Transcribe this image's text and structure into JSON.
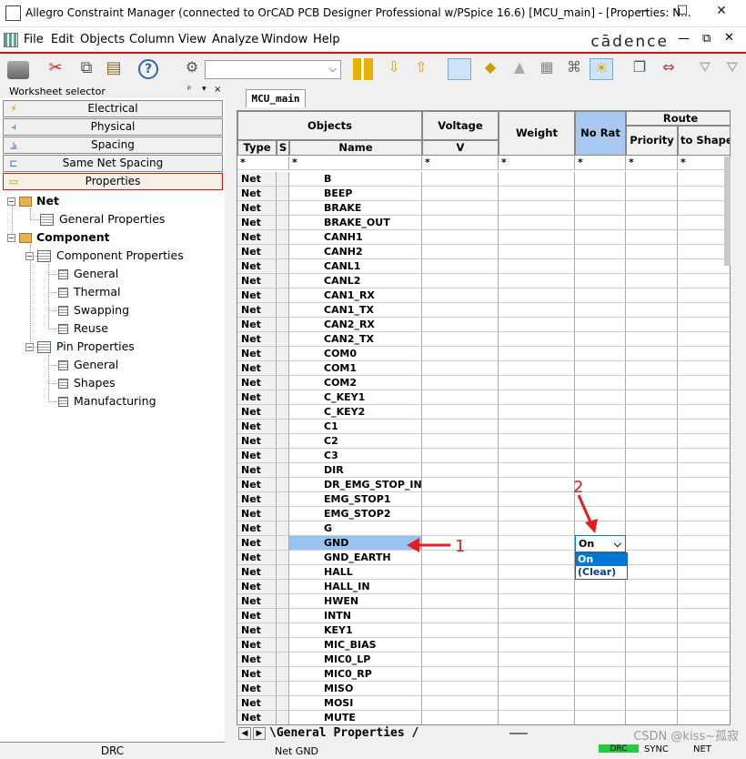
{
  "window": {
    "title": "Allegro Constraint Manager (connected to OrCAD PCB Designer Professional w/PSpice 16.6) [MCU_main] - [Properties: N...",
    "controls": [
      "—",
      "☐",
      "✕"
    ]
  },
  "menu": [
    "File",
    "Edit",
    "Objects",
    "Column",
    "View",
    "Analyze",
    "Window",
    "Help"
  ],
  "brand": "cādence",
  "mdi_controls": [
    "—",
    "⧉",
    "✕"
  ],
  "toolbar": {
    "combo_value": "",
    "combo_arrow": "⌵"
  },
  "worksheet_selector": {
    "title": "Worksheet selector",
    "pin_glyph": "ᵖ",
    "buttons": [
      {
        "label": "Electrical",
        "icon": "⚡"
      },
      {
        "label": "Physical",
        "icon": "⫞"
      },
      {
        "label": "Spacing",
        "icon": "⫡"
      },
      {
        "label": "Same Net Spacing",
        "icon": "⊏"
      },
      {
        "label": "Properties",
        "icon": "▭"
      }
    ],
    "tree": {
      "net": "Net",
      "net_children": [
        "General Properties"
      ],
      "component": "Component",
      "component_properties": "Component Properties",
      "component_children": [
        "General",
        "Thermal",
        "Swapping",
        "Reuse"
      ],
      "pin_properties": "Pin Properties",
      "pin_children": [
        "General",
        "Shapes",
        "Manufacturing"
      ]
    },
    "bottom": "DRC"
  },
  "tab": "MCU_main",
  "grid": {
    "headers": {
      "objects": "Objects",
      "type": "Type",
      "s": "S",
      "name": "Name",
      "voltage": "Voltage",
      "voltage_unit": "V",
      "weight": "Weight",
      "no_rat": "No Rat",
      "route": "Route",
      "priority": "Priority",
      "to_shape": "to Shape"
    },
    "filter": "*",
    "rows": [
      {
        "type": "Net",
        "name": "B"
      },
      {
        "type": "Net",
        "name": "BEEP"
      },
      {
        "type": "Net",
        "name": "BRAKE"
      },
      {
        "type": "Net",
        "name": "BRAKE_OUT"
      },
      {
        "type": "Net",
        "name": "CANH1"
      },
      {
        "type": "Net",
        "name": "CANH2"
      },
      {
        "type": "Net",
        "name": "CANL1"
      },
      {
        "type": "Net",
        "name": "CANL2"
      },
      {
        "type": "Net",
        "name": "CAN1_RX"
      },
      {
        "type": "Net",
        "name": "CAN1_TX"
      },
      {
        "type": "Net",
        "name": "CAN2_RX"
      },
      {
        "type": "Net",
        "name": "CAN2_TX"
      },
      {
        "type": "Net",
        "name": "COM0"
      },
      {
        "type": "Net",
        "name": "COM1"
      },
      {
        "type": "Net",
        "name": "COM2"
      },
      {
        "type": "Net",
        "name": "C_KEY1"
      },
      {
        "type": "Net",
        "name": "C_KEY2"
      },
      {
        "type": "Net",
        "name": "C1"
      },
      {
        "type": "Net",
        "name": "C2"
      },
      {
        "type": "Net",
        "name": "C3"
      },
      {
        "type": "Net",
        "name": "DIR"
      },
      {
        "type": "Net",
        "name": "DR_EMG_STOP_IN"
      },
      {
        "type": "Net",
        "name": "EMG_STOP1"
      },
      {
        "type": "Net",
        "name": "EMG_STOP2"
      },
      {
        "type": "Net",
        "name": "G"
      },
      {
        "type": "Net",
        "name": "GND"
      },
      {
        "type": "Net",
        "name": "GND_EARTH"
      },
      {
        "type": "Net",
        "name": "HALL"
      },
      {
        "type": "Net",
        "name": "HALL_IN"
      },
      {
        "type": "Net",
        "name": "HWEN"
      },
      {
        "type": "Net",
        "name": "INTN"
      },
      {
        "type": "Net",
        "name": "KEY1"
      },
      {
        "type": "Net",
        "name": "MIC_BIAS"
      },
      {
        "type": "Net",
        "name": "MIC0_LP"
      },
      {
        "type": "Net",
        "name": "MIC0_RP"
      },
      {
        "type": "Net",
        "name": "MISO"
      },
      {
        "type": "Net",
        "name": "MOSI"
      },
      {
        "type": "Net",
        "name": "MUTE"
      }
    ],
    "selected_row": "GND"
  },
  "dropdown": {
    "value": "On",
    "arrow": "⌵",
    "options": [
      "On",
      "(Clear)"
    ]
  },
  "annotations": {
    "arrow1_label": "1",
    "arrow2_label": "2",
    "arrow_glyph": "◀"
  },
  "bottom_tab": "\\General Properties /",
  "statusbar": {
    "text": "Net GND",
    "drc": "DRC",
    "sync": "SYNC",
    "net": "NET"
  },
  "watermark": "CSDN @kiss~孤寂",
  "colors": {
    "selection": "#99c4f0",
    "accent_red": "#d11",
    "dropdown_sel": "#0078d7"
  }
}
